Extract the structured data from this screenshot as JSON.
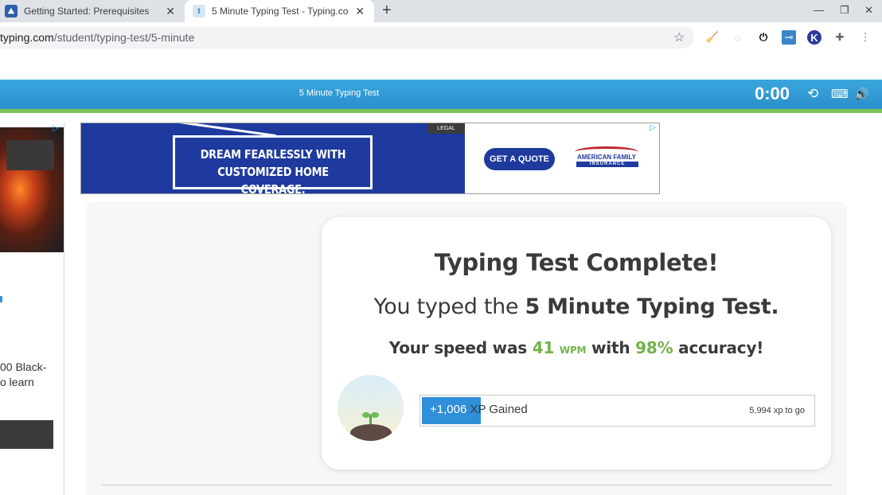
{
  "browser": {
    "tabs": [
      {
        "title": "Getting Started: Prerequisites",
        "active": false
      },
      {
        "title": "5 Minute Typing Test - Typing.co",
        "active": true
      }
    ],
    "close_glyph": "✕",
    "new_tab_glyph": "+",
    "url_host": "typing.com",
    "url_path": "/student/typing-test/5-minute",
    "window_controls": {
      "minimize": "—",
      "restore": "❐",
      "close": "✕"
    },
    "extensions": [
      "broom-icon",
      "circle-dots-icon",
      "power-icon",
      "key-card-icon",
      "k-logo-icon",
      "puzzle-icon",
      "menu-dots-icon"
    ]
  },
  "header": {
    "test_title": "5 Minute Typing Test",
    "timer": "0:00",
    "colors": {
      "header_blue": "#2b8fcc",
      "accent_green": "#7cc159"
    }
  },
  "left_ad": {
    "line1": "00 Black-",
    "line2": "o learn"
  },
  "banner_ad": {
    "headline_1": "DREAM FEARLESSLY WITH",
    "headline_2": "CUSTOMIZED HOME COVERAGE.",
    "legal": "LEGAL",
    "cta": "GET A QUOTE",
    "brand_1": "AMERICAN FAMILY",
    "brand_2": "INSURANCE"
  },
  "results": {
    "heading": "Typing Test Complete!",
    "typed_prefix": "You typed the ",
    "test_name": "5 Minute Typing Test.",
    "speed_prefix": "Your speed was ",
    "wpm_value": "41",
    "wpm_unit": "WPM",
    "speed_mid": " with ",
    "accuracy": "98%",
    "speed_suffix": " accuracy!",
    "xp_gained_number": "+1,006",
    "xp_gained_text": " XP Gained",
    "xp_to_go": "5,994 xp to go",
    "xp_progress_fraction": 0.15,
    "colors": {
      "green": "#73b34a",
      "xp_blue": "#2f8fd9"
    }
  }
}
